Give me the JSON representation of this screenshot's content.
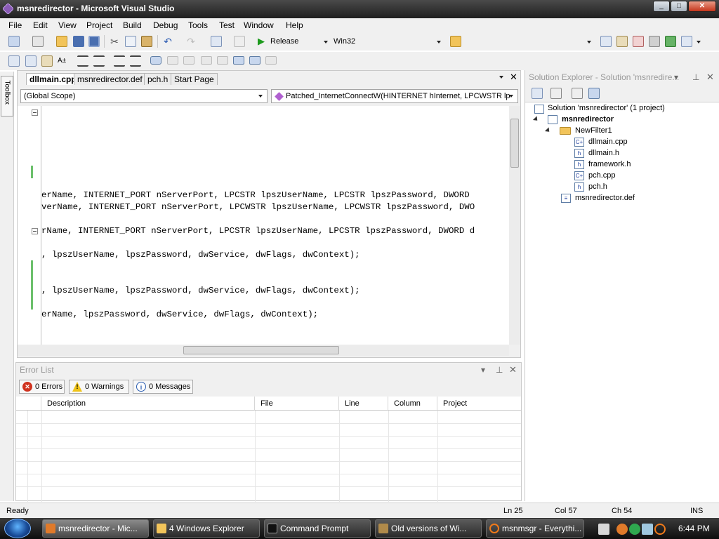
{
  "window": {
    "title": "msnredirector - Microsoft Visual Studio"
  },
  "menu": [
    "File",
    "Edit",
    "View",
    "Project",
    "Build",
    "Debug",
    "Tools",
    "Test",
    "Window",
    "Help"
  ],
  "toolbar": {
    "configuration": "Release",
    "platform": "Win32"
  },
  "toolbox": {
    "label": "Toolbox"
  },
  "editor": {
    "tabs": [
      "dllmain.cpp",
      "msnredirector.def",
      "pch.h",
      "Start Page"
    ],
    "active_tab": "dllmain.cpp",
    "scope": "(Global Scope)",
    "member": "Patched_InternetConnectW(HINTERNET hInternet, LPCWSTR lp",
    "code_lines": [
      "erName, INTERNET_PORT nServerPort, LPCSTR lpszUserName, LPCSTR lpszPassword, DWORD",
      "verName, INTERNET_PORT nServerPort, LPCWSTR lpszUserName, LPCWSTR lpszPassword, DWO",
      "rName, INTERNET_PORT nServerPort, LPCSTR lpszUserName, LPCSTR lpszPassword, DWORD d",
      ", lpszUserName, lpszPassword, dwService, dwFlags, dwContext);",
      ", lpszUserName, lpszPassword, dwService, dwFlags, dwContext);",
      "erName, lpszPassword, dwService, dwFlags, dwContext);"
    ]
  },
  "solution_explorer": {
    "title": "Solution Explorer - Solution 'msnredire...",
    "solution": "Solution 'msnredirector' (1 project)",
    "project": "msnredirector",
    "folder": "NewFilter1",
    "files": [
      "dllmain.cpp",
      "dllmain.h",
      "framework.h",
      "pch.cpp",
      "pch.h"
    ],
    "def_file": "msnredirector.def"
  },
  "error_list": {
    "title": "Error List",
    "errors": "0 Errors",
    "warnings": "0 Warnings",
    "messages": "0 Messages",
    "columns": [
      "Description",
      "File",
      "Line",
      "Column",
      "Project"
    ]
  },
  "status": {
    "ready": "Ready",
    "ln": "Ln 25",
    "col": "Col 57",
    "ch": "Ch 54",
    "mode": "INS"
  },
  "taskbar": {
    "items": [
      "msnredirector - Mic...",
      "4 Windows Explorer",
      "Command Prompt",
      "Old versions of Wi...",
      "msnmsgr - Everythi..."
    ],
    "clock": "6:44 PM"
  }
}
